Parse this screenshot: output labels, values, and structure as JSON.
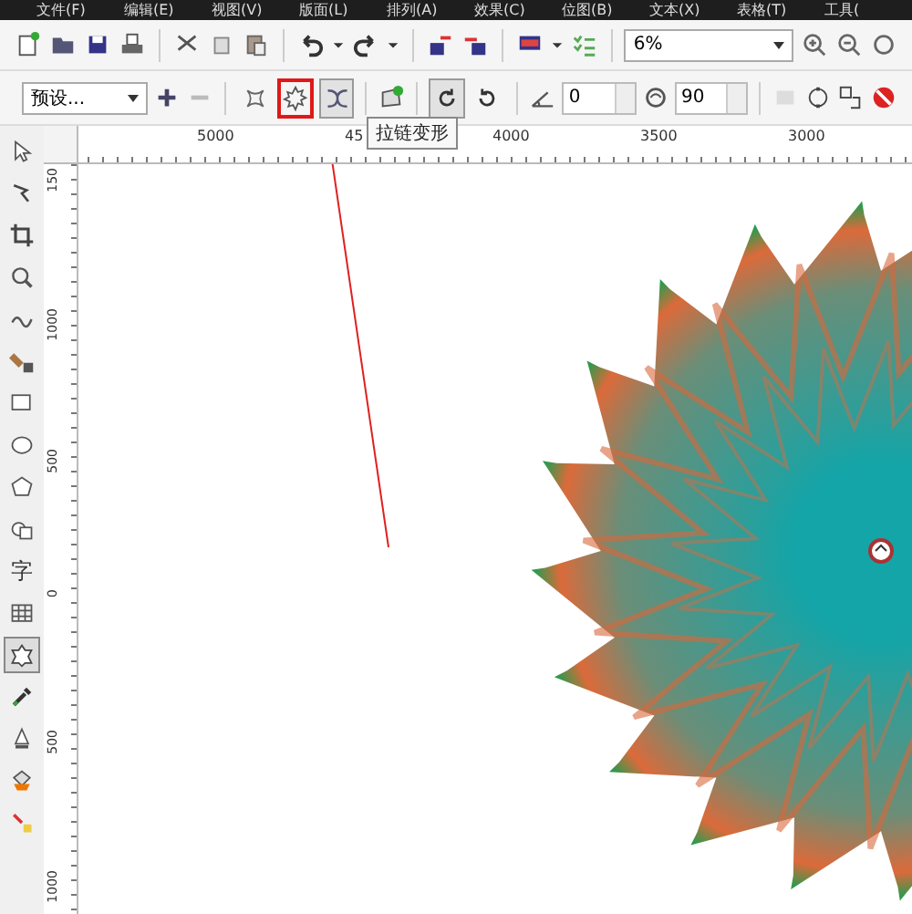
{
  "menu_bar": {
    "items": [
      "文件(F)",
      "编辑(E)",
      "视图(V)",
      "版面(L)",
      "排列(A)",
      "效果(C)",
      "位图(B)",
      "文本(X)",
      "表格(T)",
      "工具("
    ]
  },
  "standard_toolbar": {
    "zoom_field": {
      "value": "6%"
    }
  },
  "property_bar": {
    "preset_dropdown": {
      "value": "预设..."
    },
    "distortion_modes": [
      {
        "kind": "push-pull",
        "selected": false,
        "highlighted": false
      },
      {
        "kind": "zipper",
        "selected": false,
        "highlighted": true
      },
      {
        "kind": "twister",
        "selected": true,
        "highlighted": false
      }
    ],
    "rotation": [
      {
        "kind": "clockwise",
        "selected": true
      },
      {
        "kind": "counterclockwise",
        "selected": false
      }
    ],
    "angle_field": {
      "value": "0"
    },
    "amplitude_field": {
      "value": "90"
    }
  },
  "tooltip": "拉链变形",
  "ruler_top": {
    "labels": [
      "5000",
      "45",
      "4000",
      "3500",
      "3000"
    ]
  },
  "ruler_left": {
    "labels": [
      "150",
      "1000",
      "500",
      "0",
      "500",
      "1000"
    ]
  },
  "toolbox": [
    {
      "kind": "pick",
      "selected": false
    },
    {
      "kind": "shape",
      "selected": false
    },
    {
      "kind": "crop",
      "selected": false
    },
    {
      "kind": "zoom",
      "selected": false
    },
    {
      "kind": "freehand",
      "selected": false
    },
    {
      "kind": "smart-fill",
      "selected": false
    },
    {
      "kind": "rectangle",
      "selected": false
    },
    {
      "kind": "ellipse",
      "selected": false
    },
    {
      "kind": "polygon",
      "selected": false
    },
    {
      "kind": "basic-shapes",
      "selected": false
    },
    {
      "kind": "text",
      "glyph": "字",
      "selected": false
    },
    {
      "kind": "table",
      "selected": false
    },
    {
      "kind": "distort",
      "selected": true
    },
    {
      "kind": "eyedropper",
      "selected": false
    },
    {
      "kind": "outline",
      "selected": false
    },
    {
      "kind": "fill",
      "selected": false
    },
    {
      "kind": "interactive-fill",
      "selected": false
    }
  ]
}
